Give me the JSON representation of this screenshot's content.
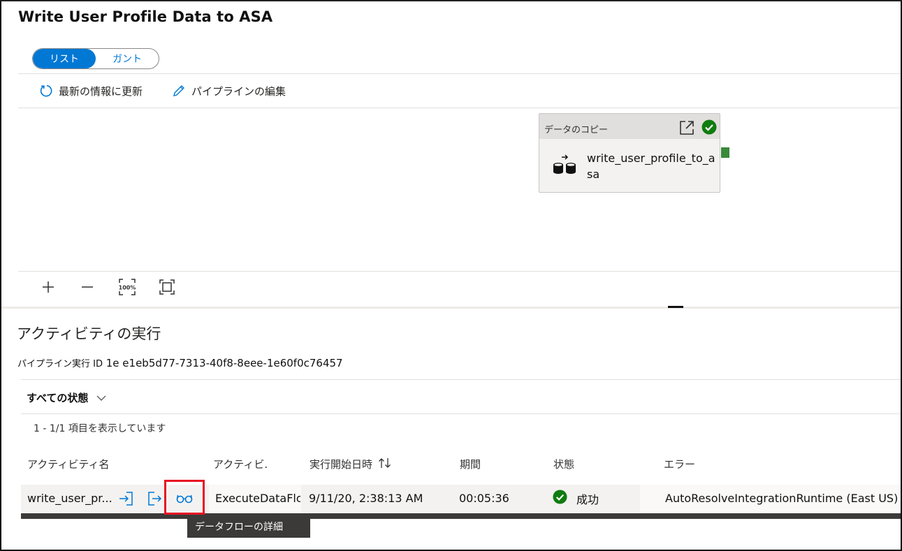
{
  "title": "Write User Profile Data to ASA",
  "view_toggle": {
    "list": "リスト",
    "gantt": "ガント",
    "selected": "リスト"
  },
  "toolbar": {
    "refresh": "最新の情報に更新",
    "edit_pipeline": "パイプラインの編集"
  },
  "canvas": {
    "activity": {
      "type_label": "データのコピー",
      "name": "write_user_profile_to_asa",
      "status_color": "#107c10"
    },
    "zoom_controls": [
      "zoom-in",
      "zoom-out",
      "zoom-100",
      "fit-to-screen"
    ],
    "zoom_100_label": "100%"
  },
  "runs": {
    "section_title": "アクティビティの実行",
    "run_id_label": "パイプライン実行 ID",
    "run_id_value": "1e e1eb5d77-7313-40f8-8eee-1e60f0c76457",
    "status_filter": "すべての状態",
    "count_text": "1 - 1/1 項目を表示しています",
    "columns": {
      "name": "アクティビティ名",
      "type": "アクティビ.",
      "start": "実行開始日時",
      "duration": "期間",
      "status": "状態",
      "error": "エラー"
    },
    "rows": [
      {
        "name": "write_user_pr...",
        "type": "ExecuteDataFlov",
        "start": "9/11/20, 2:38:13 AM",
        "duration": "00:05:36",
        "status": "成功",
        "error": "AutoResolveIntegrationRuntime (East US)"
      }
    ],
    "tooltip": "データフローの詳細"
  },
  "colors": {
    "accent": "#0078d4",
    "success": "#107c10",
    "highlight": "#e81123"
  }
}
